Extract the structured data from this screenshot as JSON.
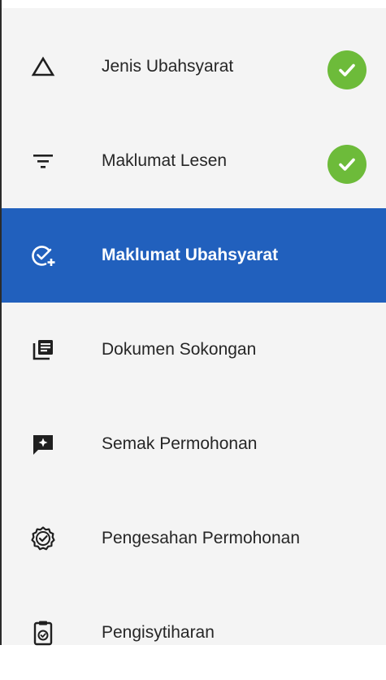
{
  "nav": {
    "items": [
      {
        "label": "Jenis Ubahsyarat",
        "icon": "triangle-outline-icon",
        "status": "completed"
      },
      {
        "label": "Maklumat Lesen",
        "icon": "filter-lines-icon",
        "status": "completed"
      },
      {
        "label": "Maklumat Ubahsyarat",
        "icon": "check-circle-plus-icon",
        "status": "active"
      },
      {
        "label": "Dokumen Sokongan",
        "icon": "document-stack-icon",
        "status": ""
      },
      {
        "label": "Semak Permohonan",
        "icon": "chat-sparkle-icon",
        "status": ""
      },
      {
        "label": "Pengesahan Permohonan",
        "icon": "verified-badge-icon",
        "status": ""
      },
      {
        "label": "Pengisytiharan",
        "icon": "clipboard-check-icon",
        "status": ""
      }
    ]
  },
  "colors": {
    "active_bg": "#2160bd",
    "completed": "#6dbb3a",
    "panel_bg": "#f4f4f4"
  }
}
